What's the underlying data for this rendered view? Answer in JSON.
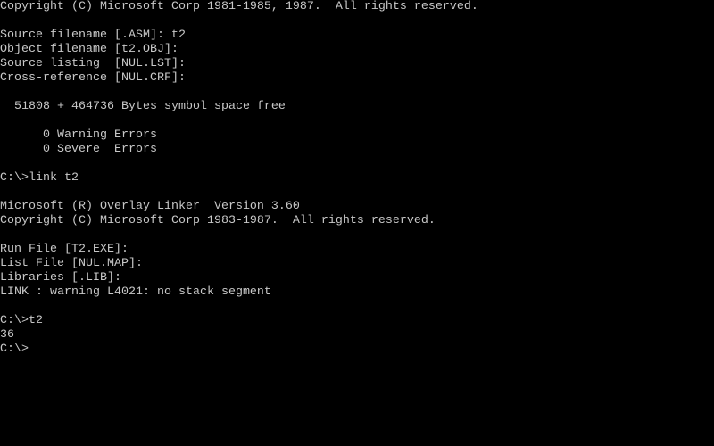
{
  "terminal": {
    "lines": [
      "Copyright (C) Microsoft Corp 1981-1985, 1987.  All rights reserved.",
      "",
      "Source filename [.ASM]: t2",
      "Object filename [t2.OBJ]:",
      "Source listing  [NUL.LST]:",
      "Cross-reference [NUL.CRF]:",
      "",
      "  51808 + 464736 Bytes symbol space free",
      "",
      "      0 Warning Errors",
      "      0 Severe  Errors",
      "",
      "C:\\>link t2",
      "",
      "Microsoft (R) Overlay Linker  Version 3.60",
      "Copyright (C) Microsoft Corp 1983-1987.  All rights reserved.",
      "",
      "Run File [T2.EXE]:",
      "List File [NUL.MAP]:",
      "Libraries [.LIB]:",
      "LINK : warning L4021: no stack segment",
      "",
      "C:\\>t2",
      "36",
      "C:\\>"
    ]
  }
}
